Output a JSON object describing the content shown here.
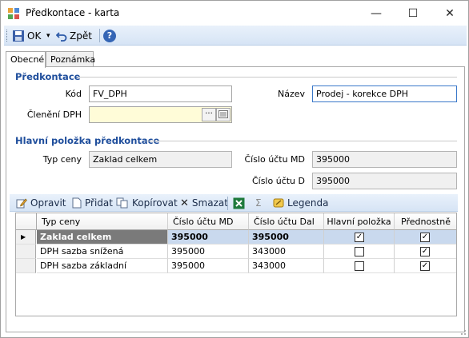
{
  "window": {
    "title": "Předkontace - karta",
    "minimize_glyph": "—",
    "maximize_glyph": "☐",
    "close_glyph": "✕"
  },
  "toolbar": {
    "ok_label": "OK",
    "back_label": "Zpět",
    "dropdown_glyph": "▾",
    "help_glyph": "?"
  },
  "tabs": [
    {
      "label": "Obecné",
      "active": true
    },
    {
      "label": "Poznámka",
      "active": false
    }
  ],
  "predkontace": {
    "section_title": "Předkontace",
    "kod_label": "Kód",
    "kod_value": "FV_DPH",
    "nazev_label": "Název",
    "nazev_value": "Prodej - korekce DPH",
    "cleneni_label": "Členění DPH",
    "cleneni_value": "",
    "ellipsis": "···"
  },
  "hlavni": {
    "section_title": "Hlavní položka předkontace",
    "typ_ceny_label": "Typ ceny",
    "typ_ceny_value": "Zaklad celkem",
    "ucet_md_label": "Číslo účtu MD",
    "ucet_md_value": "395000",
    "ucet_d_label": "Číslo účtu D",
    "ucet_d_value": "395000"
  },
  "grid_toolbar": {
    "edit_label": "Opravit",
    "add_label": "Přidat",
    "copy_label": "Kopírovat",
    "delete_label": "Smazat",
    "sum_glyph": "Σ",
    "legend_label": "Legenda"
  },
  "grid": {
    "columns": [
      "Typ ceny",
      "Číslo účtu MD",
      "Číslo účtu Dal",
      "Hlavní položka",
      "Přednostně"
    ],
    "current_row_glyph": "▶",
    "check_glyph": "✓",
    "rows": [
      {
        "typ": "Zaklad celkem",
        "md": "395000",
        "dal": "395000",
        "hlavni": true,
        "prednostne": true
      },
      {
        "typ": "DPH sazba snížená",
        "md": "395000",
        "dal": "343000",
        "hlavni": false,
        "prednostne": true
      },
      {
        "typ": "DPH sazba základní",
        "md": "395000",
        "dal": "343000",
        "hlavni": false,
        "prednostne": true
      }
    ]
  },
  "colors": {
    "accent": "#1f4e9c",
    "toolbar_bg": "#dce8f7",
    "selected_row": "#c9d9ee"
  }
}
